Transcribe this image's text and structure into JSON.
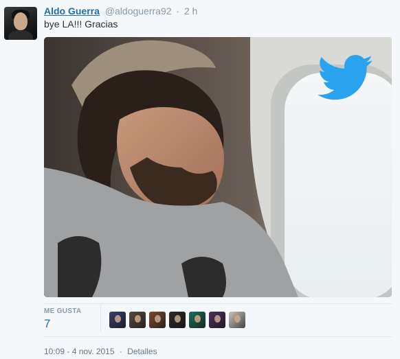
{
  "tweet": {
    "display_name": "Aldo Guerra",
    "handle": "@aldoguerra92",
    "separator": "·",
    "relative_time": "2 h",
    "text": "bye LA!!! Gracias"
  },
  "engagement": {
    "likes_label": "ME GUSTA",
    "likes_count": "7",
    "likers": [
      {
        "name": "liker-avatar-1",
        "color": "#3b3f6b"
      },
      {
        "name": "liker-avatar-2",
        "color": "#5a4a3e"
      },
      {
        "name": "liker-avatar-3",
        "color": "#7a4b2f"
      },
      {
        "name": "liker-avatar-4",
        "color": "#2b2b2b"
      },
      {
        "name": "liker-avatar-5",
        "color": "#1f6b5a"
      },
      {
        "name": "liker-avatar-6",
        "color": "#4c2f5e"
      },
      {
        "name": "liker-avatar-7",
        "color": "#c9c3bd"
      }
    ]
  },
  "footer": {
    "timestamp": "10:09 - 4 nov. 2015",
    "separator": "·",
    "details_label": "Detalles"
  },
  "colors": {
    "link": "#1f6fa8",
    "muted": "#8899a6",
    "twitter_blue": "#2aa3ef"
  },
  "icons": {
    "media_watermark": "twitter-bird-icon"
  }
}
